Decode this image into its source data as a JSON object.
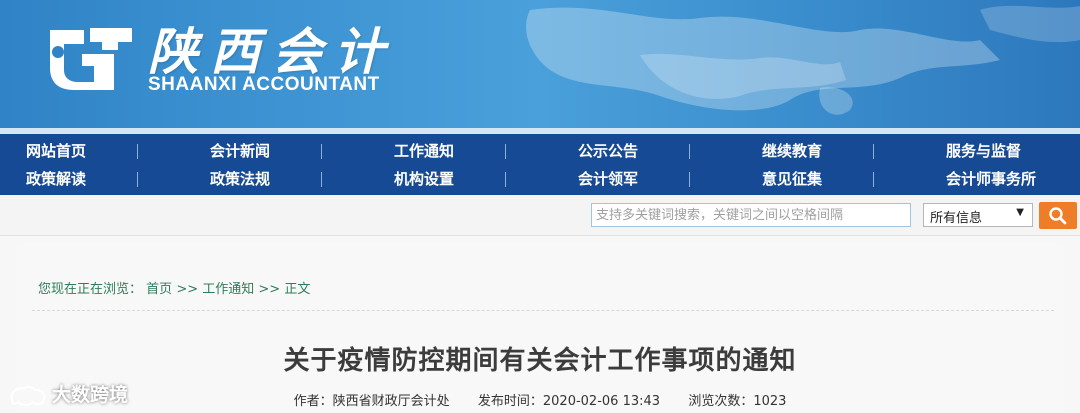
{
  "header": {
    "title": "陕西会计",
    "subtitle": "SHAANXI ACCOUNTANT"
  },
  "nav": {
    "row1": [
      "网站首页",
      "会计新闻",
      "工作通知",
      "公示公告",
      "继续教育",
      "服务与监督"
    ],
    "row2": [
      "政策解读",
      "政策法规",
      "机构设置",
      "会计领军",
      "意见征集",
      "会计师事务所"
    ]
  },
  "search": {
    "placeholder": "支持多关键词搜索，关键词之间以空格间隔",
    "scope_value": "所有信息",
    "button_icon": "search-icon"
  },
  "breadcrumb": {
    "prefix": "您现在正在浏览：",
    "items": [
      "首页",
      "工作通知",
      "正文"
    ],
    "separator": ">>"
  },
  "article": {
    "title": "关于疫情防控期间有关会计工作事项的通知",
    "author_label": "作者：",
    "author": "陕西省财政厅会计处",
    "published_label": "发布时间：",
    "published": "2020-02-06 13:43",
    "views_label": "浏览次数：",
    "views": "1023"
  },
  "watermark": {
    "text": "大数跨境"
  },
  "colors": {
    "nav_bg": "#164a94",
    "banner": "#3d93d2",
    "search_button": "#ef7c26",
    "breadcrumb": "#2f7b5a"
  }
}
